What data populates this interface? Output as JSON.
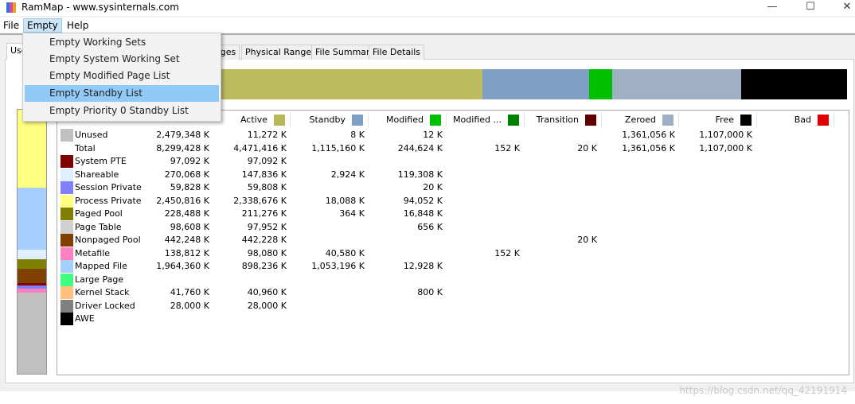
{
  "window": {
    "title": "RamMap - www.sysinternals.com",
    "minimize": "—",
    "maximize": "☐",
    "close": "✕"
  },
  "menubar": [
    "File",
    "Empty",
    "Help"
  ],
  "dropdown": {
    "items": [
      "Empty Working Sets",
      "Empty System Working Set",
      "Empty Modified Page List",
      "Empty Standby List",
      "Empty Priority 0 Standby List"
    ],
    "selected": "Empty Standby List"
  },
  "tabs": [
    "Use",
    "ages",
    "Physical Ranges",
    "File Summary",
    "File Details"
  ],
  "columns": [
    {
      "label": "Active",
      "color": "#b8b85a"
    },
    {
      "label": "Standby",
      "color": "#7f9fc4"
    },
    {
      "label": "Modified",
      "color": "#00c000"
    },
    {
      "label": "Modified ...",
      "color": "#008000"
    },
    {
      "label": "Transition",
      "color": "#600000"
    },
    {
      "label": "Zeroed",
      "color": "#a0b0c4"
    },
    {
      "label": "Free",
      "color": "#000000"
    },
    {
      "label": "Bad",
      "color": "#e00000"
    }
  ],
  "rows": [
    {
      "name": "Unused",
      "color": "#c0c0c0",
      "v": [
        "2,479,348 K",
        "11,272 K",
        "8 K",
        "12 K",
        "",
        "",
        "1,361,056 K",
        "1,107,000 K",
        ""
      ]
    },
    {
      "name": "Total",
      "color": "",
      "v": [
        "8,299,428 K",
        "4,471,416 K",
        "1,115,160 K",
        "244,624 K",
        "152 K",
        "20 K",
        "1,361,056 K",
        "1,107,000 K",
        ""
      ]
    },
    {
      "name": "System PTE",
      "color": "#800000",
      "v": [
        "97,092 K",
        "97,092 K",
        "",
        "",
        "",
        "",
        "",
        "",
        ""
      ]
    },
    {
      "name": "Shareable",
      "color": "#dfefff",
      "v": [
        "270,068 K",
        "147,836 K",
        "2,924 K",
        "119,308 K",
        "",
        "",
        "",
        "",
        ""
      ]
    },
    {
      "name": "Session Private",
      "color": "#8080ff",
      "v": [
        "59,828 K",
        "59,808 K",
        "",
        "20 K",
        "",
        "",
        "",
        "",
        ""
      ]
    },
    {
      "name": "Process Private",
      "color": "#ffff80",
      "v": [
        "2,450,816 K",
        "2,338,676 K",
        "18,088 K",
        "94,052 K",
        "",
        "",
        "",
        "",
        ""
      ]
    },
    {
      "name": "Paged Pool",
      "color": "#808000",
      "v": [
        "228,488 K",
        "211,276 K",
        "364 K",
        "16,848 K",
        "",
        "",
        "",
        "",
        ""
      ]
    },
    {
      "name": "Page Table",
      "color": "#d0d0d0",
      "v": [
        "98,608 K",
        "97,952 K",
        "",
        "656 K",
        "",
        "",
        "",
        "",
        ""
      ]
    },
    {
      "name": "Nonpaged Pool",
      "color": "#804000",
      "v": [
        "442,248 K",
        "442,228 K",
        "",
        "",
        "",
        "20 K",
        "",
        "",
        ""
      ]
    },
    {
      "name": "Metafile",
      "color": "#ff80c0",
      "v": [
        "138,812 K",
        "98,080 K",
        "40,580 K",
        "",
        "152 K",
        "",
        "",
        "",
        ""
      ]
    },
    {
      "name": "Mapped File",
      "color": "#a6cfff",
      "v": [
        "1,964,360 K",
        "898,236 K",
        "1,053,196 K",
        "12,928 K",
        "",
        "",
        "",
        "",
        ""
      ]
    },
    {
      "name": "Large Page",
      "color": "#40ff80",
      "v": [
        "",
        "",
        "",
        "",
        "",
        "",
        "",
        "",
        ""
      ]
    },
    {
      "name": "Kernel Stack",
      "color": "#ffc080",
      "v": [
        "41,760 K",
        "40,960 K",
        "",
        "800 K",
        "",
        "",
        "",
        "",
        ""
      ]
    },
    {
      "name": "Driver Locked",
      "color": "#808080",
      "v": [
        "28,000 K",
        "28,000 K",
        "",
        "",
        "",
        "",
        "",
        "",
        ""
      ]
    },
    {
      "name": "AWE",
      "color": "#000000",
      "v": [
        "",
        "",
        "",
        "",
        "",
        "",
        "",
        "",
        ""
      ]
    }
  ],
  "watermark": "https://blog.csdn.net/qq_42191914"
}
